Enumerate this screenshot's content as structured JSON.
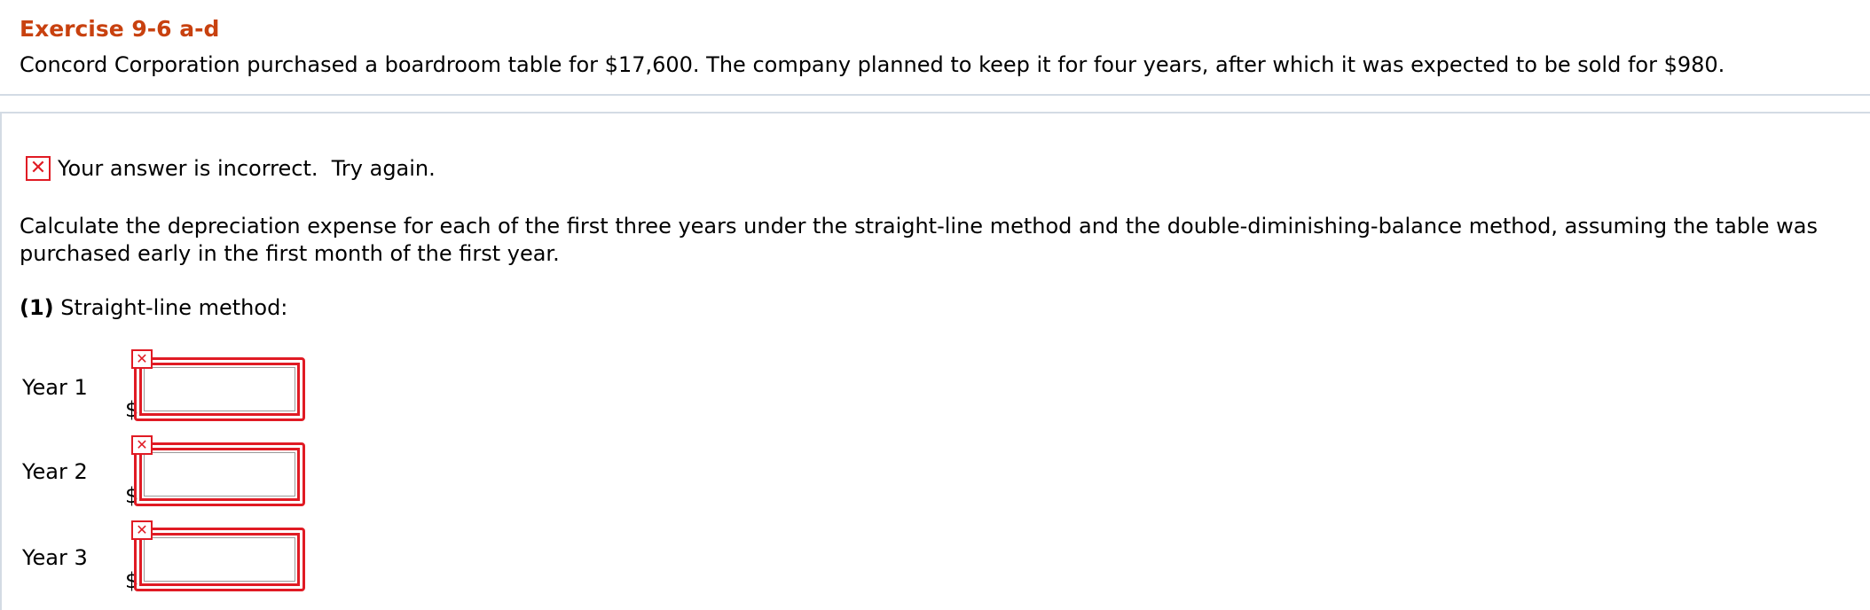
{
  "exercise": {
    "title": "Exercise 9-6 a-d",
    "intro": "Concord Corporation purchased a boardroom table for $17,600. The company planned to keep it for four years, after which it was expected to be sold for $980."
  },
  "feedback": {
    "icon": "x-icon",
    "text": "Your answer is incorrect.  Try again."
  },
  "question": {
    "text": "Calculate the depreciation expense for each of the first three years under the straight-line method and the double-diminishing-balance method, assuming the table was purchased early in the first month of the first year.",
    "part_number": "(1)",
    "part_label": " Straight-line method:"
  },
  "rows": [
    {
      "label": "Year 1",
      "currency": "$",
      "value": ""
    },
    {
      "label": "Year 2",
      "currency": "$",
      "value": ""
    },
    {
      "label": "Year 3",
      "currency": "$",
      "value": ""
    }
  ],
  "colors": {
    "title": "#c8410f",
    "error": "#e01b24",
    "panel_border": "#d3dbe4"
  }
}
